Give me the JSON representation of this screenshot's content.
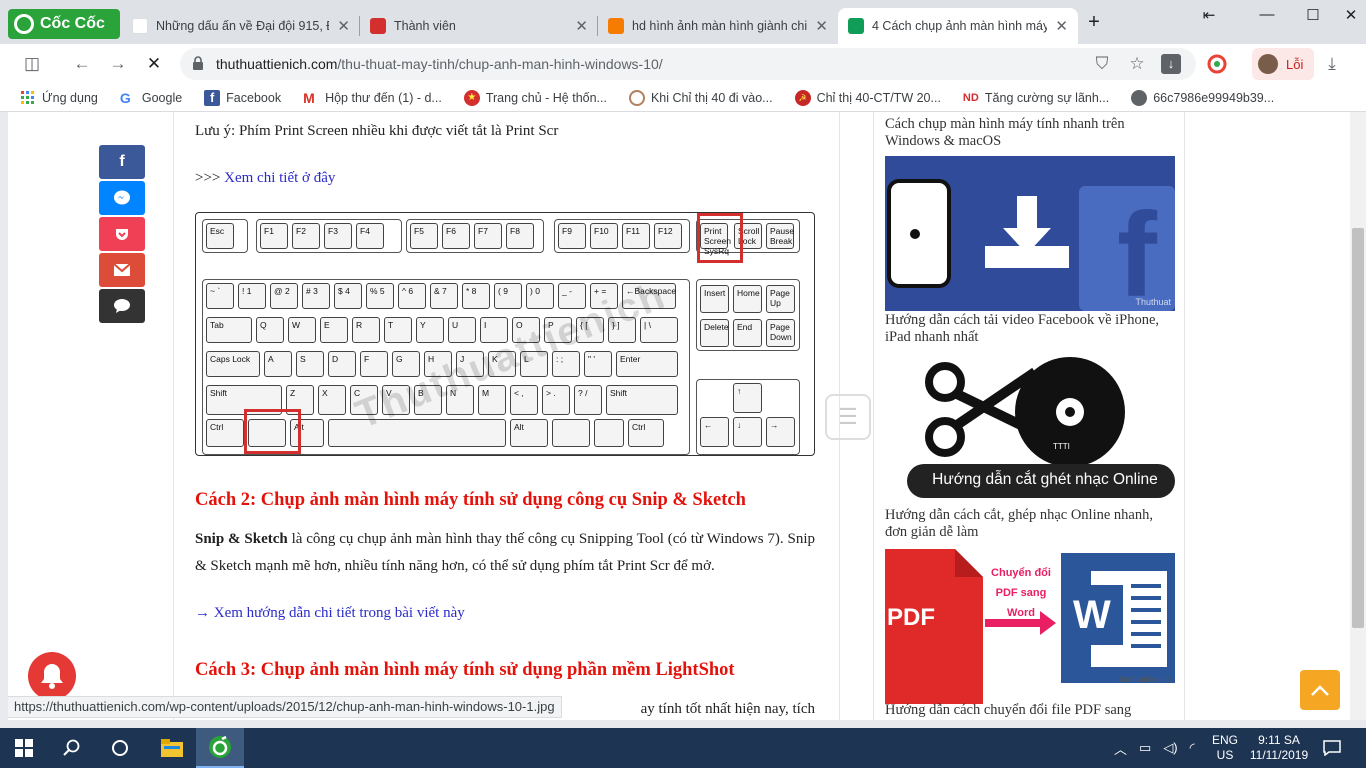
{
  "browser": {
    "brand": "Cốc Cốc",
    "tabs": [
      {
        "title": "Những dấu ấn về Đại đội 915, Đội",
        "fav": "#c62828"
      },
      {
        "title": "Thành viên",
        "fav": "#d32f2f"
      },
      {
        "title": "hd hình ảnh màn hình giành chiến",
        "fav": "#f57c00"
      },
      {
        "title": "4 Cách chụp ảnh màn hình máy tín",
        "fav": "#0f9d58"
      }
    ],
    "new_tab": "+",
    "url_domain": "thuthuattienich.com",
    "url_path": "/thu-thuat-may-tinh/chup-anh-man-hinh-windows-10/",
    "profile_label": "Lỗi"
  },
  "bookmarks": [
    {
      "label": "Ứng dụng",
      "icon": "apps-icon"
    },
    {
      "label": "Google",
      "icon": "google-icon"
    },
    {
      "label": "Facebook",
      "icon": "facebook-icon"
    },
    {
      "label": "Hộp thư đến (1) - d...",
      "icon": "gmail-icon"
    },
    {
      "label": "Trang chủ - Hệ thốn...",
      "icon": "emblem-icon"
    },
    {
      "label": "Khi Chỉ thị 40 đi vào...",
      "icon": "globe-icon"
    },
    {
      "label": "Chỉ thị 40-CT/TW 20...",
      "icon": "party-icon"
    },
    {
      "label": "Tăng cường sự lãnh...",
      "icon": "nd-icon"
    },
    {
      "label": "66c7986e99949b39...",
      "icon": "site-icon"
    }
  ],
  "article": {
    "note": "Lưu ý: Phím Print Screen nhiều khi được viết tắt là Print Scr",
    "more_prefix": ">>> ",
    "more_link": "Xem chi tiết ở đây",
    "h2_1": "Cách 2: Chụp ảnh màn hình máy tính sử dụng công cụ Snip & Sketch",
    "p1_bold": "Snip & Sketch",
    "p1_rest": " là công cụ chụp ảnh màn hình thay thế công cụ Snipping Tool (có từ Windows 7). Snip & Sketch mạnh mẽ hơn, nhiều tính năng hơn, có thể sử dụng phím tắt Print Scr để mở.",
    "guide_arrow": "→ ",
    "guide_link": "Xem hướng dẫn chi tiết trong bài viết này",
    "h2_2": "Cách 3: Chụp ảnh màn hình máy tính sử dụng phần mềm LightShot",
    "p2_tail": "ay tính tốt nhất hiện nay, tích",
    "watermark": "Thuthuattienich"
  },
  "keyboard": {
    "row_fn": [
      "Esc",
      "F1",
      "F2",
      "F3",
      "F4",
      "F5",
      "F6",
      "F7",
      "F8",
      "F9",
      "F10",
      "F11",
      "F12",
      "Print Screen SysRq",
      "Scroll Lock",
      "Pause Break"
    ],
    "row_num": [
      "~ `",
      "! 1",
      "@ 2",
      "# 3",
      "$ 4",
      "% 5",
      "^ 6",
      "& 7",
      "* 8",
      "( 9",
      ") 0",
      "_ -",
      "+ =",
      "←Backspace"
    ],
    "row_tab": [
      "Tab",
      "Q",
      "W",
      "E",
      "R",
      "T",
      "Y",
      "U",
      "I",
      "O",
      "P",
      "{ [",
      "} ]",
      "| \\"
    ],
    "row_caps": [
      "Caps Lock",
      "A",
      "S",
      "D",
      "F",
      "G",
      "H",
      "J",
      "K",
      "L",
      ": ;",
      "\" '",
      "Enter"
    ],
    "row_shift": [
      "Shift",
      "Z",
      "X",
      "C",
      "V",
      "B",
      "N",
      "M",
      "< ,",
      "> .",
      "? /",
      "Shift"
    ],
    "row_ctrl": [
      "Ctrl",
      "",
      "Alt",
      "",
      "Alt",
      "",
      "",
      "Ctrl"
    ],
    "nav1": [
      "Insert",
      "Home",
      "Page Up"
    ],
    "nav2": [
      "Delete",
      "End",
      "Page Down"
    ],
    "arrows": [
      "↑",
      "←",
      "↓",
      "→"
    ]
  },
  "sidebar": {
    "cap0": "Cách chụp màn hình máy tính nhanh trên Windows & macOS",
    "cap1": "Hướng dẫn cách tải video Facebook về iPhone, iPad nhanh nhất",
    "thumb1_mark": "Thuthuat",
    "cap2": "Hướng dẫn cách cắt, ghép nhạc Online nhanh, đơn giản dễ làm",
    "thumb2_text": "Hướng dẫn cắt ghét nhạc Online",
    "thumb2_small": "TTTI",
    "cap3": "Hướng dẫn cách chuyển đổi file PDF sang",
    "thumb3_label": "Chuyển đổi PDF sang Word",
    "thumb3_pdf": "PDF",
    "thumb3_w": "W",
    "thumb3_mark": "thuthuattienich"
  },
  "status_url": "https://thuthuattienich.com/wp-content/uploads/2015/12/chup-anh-man-hinh-windows-10-1.jpg",
  "taskbar": {
    "lang1": "ENG",
    "lang2": "US",
    "time": "9:11 SA",
    "date": "11/11/2019"
  }
}
